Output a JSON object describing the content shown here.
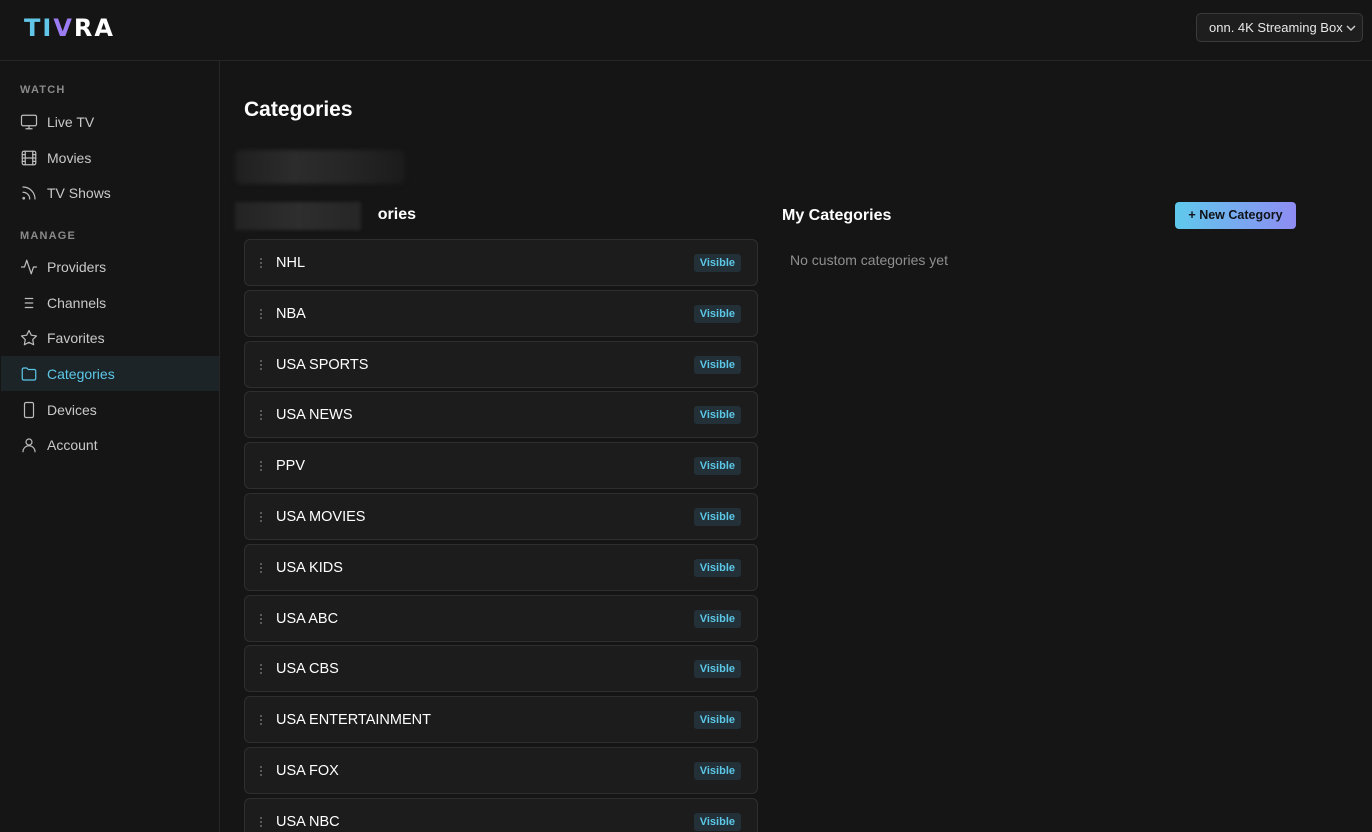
{
  "app": {
    "logo": {
      "part1": "TI",
      "part2": "V",
      "part3": "RA"
    },
    "device_selector": {
      "value": "onn. 4K Streaming Box"
    }
  },
  "sidebar": {
    "watch_label": "WATCH",
    "manage_label": "MANAGE",
    "watch_items": [
      {
        "label": "Live TV",
        "icon": "monitor-icon"
      },
      {
        "label": "Movies",
        "icon": "film-icon"
      },
      {
        "label": "TV Shows",
        "icon": "rss-icon"
      }
    ],
    "manage_items": [
      {
        "label": "Providers",
        "icon": "activity-icon"
      },
      {
        "label": "Channels",
        "icon": "list-icon"
      },
      {
        "label": "Favorites",
        "icon": "star-icon"
      },
      {
        "label": "Categories",
        "icon": "folder-icon",
        "active": true
      },
      {
        "label": "Devices",
        "icon": "smartphone-icon"
      },
      {
        "label": "Account",
        "icon": "user-icon"
      }
    ]
  },
  "main": {
    "page_title": "Categories",
    "system_section_title_visible_part": "ories",
    "my_section_title": "My Categories",
    "new_category_button": "+ New Category",
    "empty_state": "No custom categories yet",
    "categories": [
      {
        "name": "NHL",
        "status": "Visible"
      },
      {
        "name": "NBA",
        "status": "Visible"
      },
      {
        "name": "USA SPORTS",
        "status": "Visible"
      },
      {
        "name": "USA NEWS",
        "status": "Visible"
      },
      {
        "name": "PPV",
        "status": "Visible"
      },
      {
        "name": "USA MOVIES",
        "status": "Visible"
      },
      {
        "name": "USA KIDS",
        "status": "Visible"
      },
      {
        "name": "USA ABC",
        "status": "Visible"
      },
      {
        "name": "USA CBS",
        "status": "Visible"
      },
      {
        "name": "USA ENTERTAINMENT",
        "status": "Visible"
      },
      {
        "name": "USA FOX",
        "status": "Visible"
      },
      {
        "name": "USA NBC",
        "status": "Visible"
      }
    ]
  },
  "colors": {
    "accent": "#5cc8e8",
    "accent_purple": "#8e8cf3",
    "background": "#151515",
    "row_background": "#1c1c1c"
  }
}
